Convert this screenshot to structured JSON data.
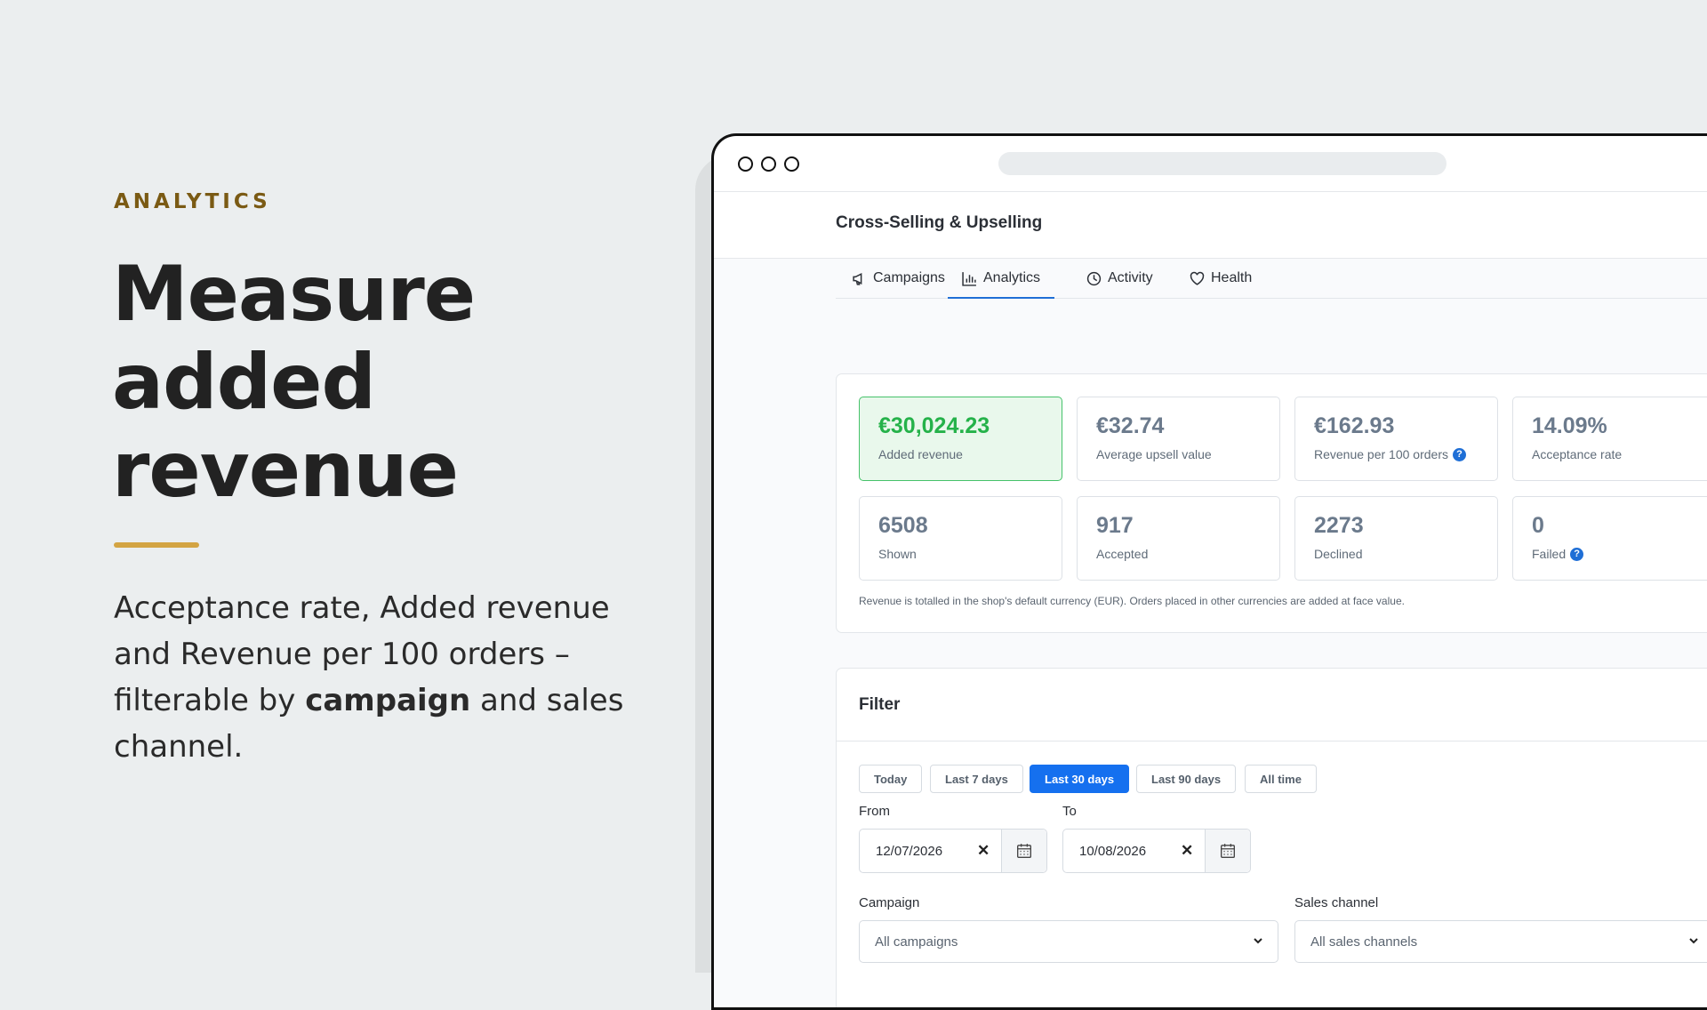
{
  "marketing": {
    "kicker": "ANALYTICS",
    "headline": [
      "Measure",
      "added",
      "revenue"
    ],
    "description_parts": {
      "before": "Acceptance rate, Added revenue and Revenue per 100 orders – filterable by ",
      "bold": "campaign",
      "after": " and sales channel."
    },
    "accent_color": "#d3a443",
    "kicker_color": "#7a5a14"
  },
  "app": {
    "title": "Cross-Selling & Upselling",
    "tabs": [
      {
        "label": "Campaigns",
        "icon": "megaphone-icon",
        "active": false
      },
      {
        "label": "Analytics",
        "icon": "bar-chart-icon",
        "active": true
      },
      {
        "label": "Activity",
        "icon": "clock-icon",
        "active": false
      },
      {
        "label": "Health",
        "icon": "heart-icon",
        "active": false
      }
    ],
    "stats": [
      {
        "value": "€30,024.23",
        "label": "Added revenue",
        "highlight": true,
        "help": false
      },
      {
        "value": "€32.74",
        "label": "Average upsell value",
        "highlight": false,
        "help": false
      },
      {
        "value": "€162.93",
        "label": "Revenue per 100 orders",
        "highlight": false,
        "help": true
      },
      {
        "value": "14.09%",
        "label": "Acceptance rate",
        "highlight": false,
        "help": false
      },
      {
        "value": "6508",
        "label": "Shown",
        "highlight": false,
        "help": false
      },
      {
        "value": "917",
        "label": "Accepted",
        "highlight": false,
        "help": false
      },
      {
        "value": "2273",
        "label": "Declined",
        "highlight": false,
        "help": false
      },
      {
        "value": "0",
        "label": "Failed",
        "highlight": false,
        "help": true
      }
    ],
    "help_glyph": "?",
    "currency_note": "Revenue is totalled in the shop's default currency (EUR). Orders placed in other currencies are added at face value.",
    "filter": {
      "title": "Filter",
      "ranges": [
        {
          "label": "Today",
          "active": false
        },
        {
          "label": "Last 7 days",
          "active": false
        },
        {
          "label": "Last 30 days",
          "active": true
        },
        {
          "label": "Last 90 days",
          "active": false
        },
        {
          "label": "All time",
          "active": false
        }
      ],
      "from_label": "From",
      "from_value": "12/07/2026",
      "to_label": "To",
      "to_value": "10/08/2026",
      "clear_glyph": "✕",
      "campaign_label": "Campaign",
      "campaign_value": "All campaigns",
      "channel_label": "Sales channel",
      "channel_value": "All sales channels"
    },
    "colors": {
      "primary": "#1570ef",
      "success": "#25b24a",
      "success_bg": "#e9f8ec"
    }
  }
}
